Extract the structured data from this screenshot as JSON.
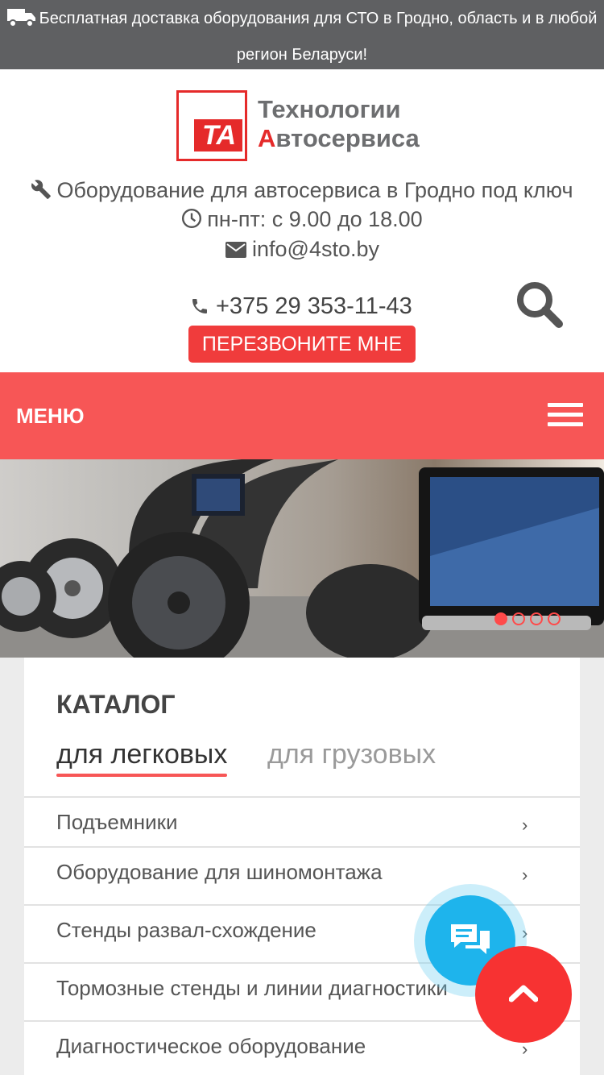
{
  "topbar": {
    "text": "Бесплатная доставка оборудования для СТО в Гродно, область и в любой регион Беларуси!",
    "truck_icon": "truck-icon"
  },
  "logo": {
    "mark": "ТА",
    "line1": "Технологии",
    "line2_first": "А",
    "line2_rest": "втосервиса"
  },
  "header": {
    "tagline": "Оборудование для автосервиса в Гродно под ключ",
    "hours": "пн-пт: с 9.00 до 18.00",
    "email": "info@4sto.by",
    "phone": "+375 29 353-11-43",
    "callback_label": "ПЕРЕЗВОНИТЕ МНЕ",
    "icons": [
      "wrench-icon",
      "clock-icon",
      "mail-icon",
      "phone-icon",
      "search-icon"
    ]
  },
  "menu": {
    "label": "МЕНЮ",
    "icon": "hamburger-icon"
  },
  "banner": {
    "slides_total": 4,
    "active_slide": 1
  },
  "catalog": {
    "title": "КАТАЛОГ",
    "tabs": [
      {
        "label": "для легковых",
        "active": true
      },
      {
        "label": "для грузовых",
        "active": false
      }
    ],
    "items": [
      {
        "label": "Подъемники"
      },
      {
        "label": "Оборудование для шиномонтажа"
      },
      {
        "label": "Стенды развал-схождение"
      },
      {
        "label": "Тормозные стенды и линии диагностики"
      },
      {
        "label": "Диагностическое оборудование"
      }
    ],
    "chevron": "›"
  },
  "floating": {
    "chat_icon": "chat-icon",
    "scroll_top_icon": "chevron-up-icon"
  },
  "colors": {
    "accent": "#f75656",
    "topbar": "#5f6062",
    "chat": "#1eb4ec",
    "scroll_top": "#f73232"
  }
}
